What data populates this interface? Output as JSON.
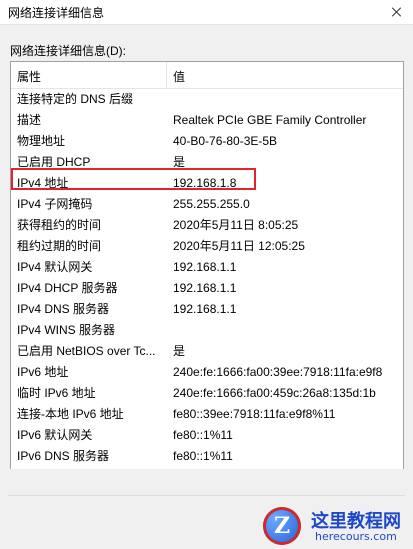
{
  "window": {
    "title": "网络连接详细信息"
  },
  "section_label": "网络连接详细信息(D):",
  "table": {
    "columns": [
      "属性",
      "值"
    ],
    "rows": [
      {
        "key": "连接特定的 DNS 后缀",
        "value": ""
      },
      {
        "key": "描述",
        "value": "Realtek PCIe GBE Family Controller"
      },
      {
        "key": "物理地址",
        "value": "40-B0-76-80-3E-5B"
      },
      {
        "key": "已启用 DHCP",
        "value": "是"
      },
      {
        "key": "IPv4 地址",
        "value": "192.168.1.8"
      },
      {
        "key": "IPv4 子网掩码",
        "value": "255.255.255.0"
      },
      {
        "key": "获得租约的时间",
        "value": "2020年5月11日 8:05:25"
      },
      {
        "key": "租约过期的时间",
        "value": "2020年5月11日 12:05:25"
      },
      {
        "key": "IPv4 默认网关",
        "value": "192.168.1.1"
      },
      {
        "key": "IPv4 DHCP 服务器",
        "value": "192.168.1.1"
      },
      {
        "key": "IPv4 DNS 服务器",
        "value": "192.168.1.1"
      },
      {
        "key": "IPv4 WINS 服务器",
        "value": ""
      },
      {
        "key": "已启用 NetBIOS over Tc...",
        "value": "是"
      },
      {
        "key": "IPv6 地址",
        "value": "240e:fe:1666:fa00:39ee:7918:11fa:e9f8"
      },
      {
        "key": "临时 IPv6 地址",
        "value": "240e:fe:1666:fa00:459c:26a8:135d:1b"
      },
      {
        "key": "连接-本地 IPv6 地址",
        "value": "fe80::39ee:7918:11fa:e9f8%11"
      },
      {
        "key": "IPv6 默认网关",
        "value": "fe80::1%11"
      },
      {
        "key": "IPv6 DNS 服务器",
        "value": "fe80::1%11"
      }
    ]
  },
  "watermark": {
    "logo_letter": "Z",
    "text": "这里教程网",
    "url": "herecours.com"
  },
  "colors": {
    "highlight": "#e0242b",
    "watermark": "#1f47c9"
  }
}
